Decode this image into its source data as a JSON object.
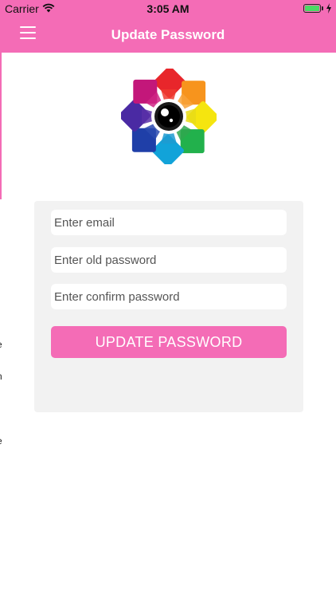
{
  "status_bar": {
    "carrier": "Carrier",
    "time": "3:05 AM",
    "battery_level": 1.0,
    "battery_color": "#4cd964"
  },
  "nav_bar": {
    "title": "Update Password",
    "menu_icon": "hamburger-menu-icon",
    "background_color": "#f46cb6"
  },
  "logo": {
    "icon": "color-wheel-camera-logo"
  },
  "form": {
    "email_placeholder": "Enter email",
    "old_password_placeholder": "Enter old password",
    "confirm_password_placeholder": "Enter confirm password",
    "submit_label": "UPDATE PASSWORD"
  },
  "drawer_edge_chars": [
    "e",
    "n",
    "e"
  ],
  "colors": {
    "accent": "#f46cb6",
    "card_background": "#f2f2f2"
  }
}
